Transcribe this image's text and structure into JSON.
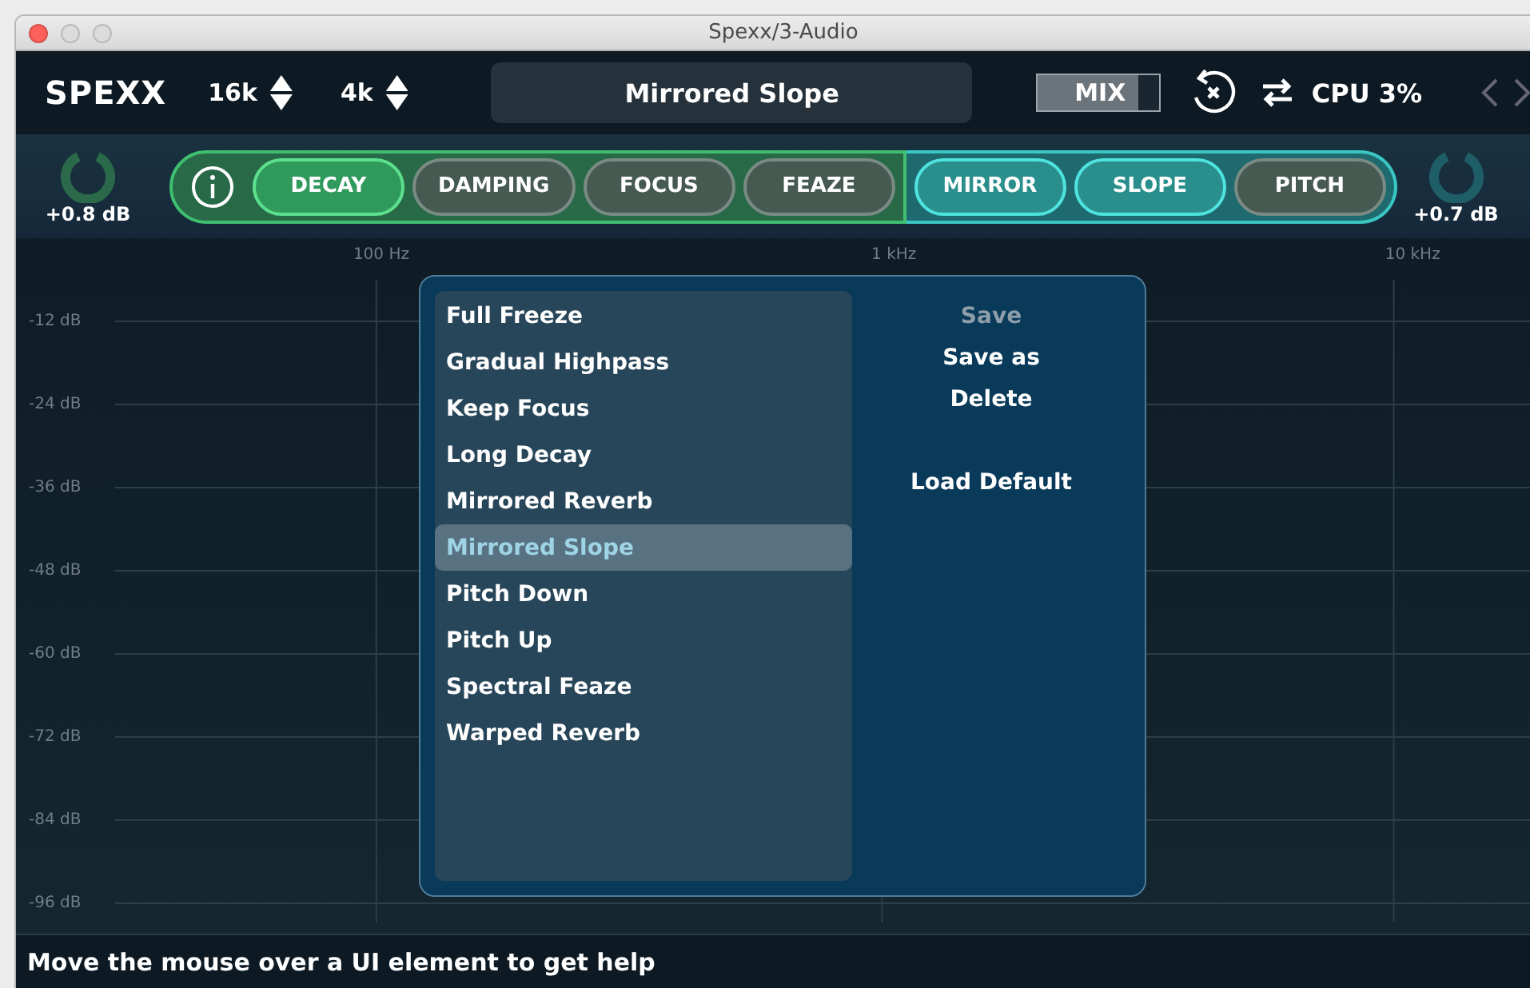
{
  "window": {
    "title": "Spexx/3-Audio"
  },
  "header": {
    "logo": "SPEXX",
    "steppers": [
      {
        "value": "16k"
      },
      {
        "value": "4k"
      }
    ],
    "preset": "Mirrored Slope",
    "mix": {
      "label": "MIX",
      "level": 0.82
    },
    "cpu": "CPU 3%"
  },
  "module_bar": {
    "input_gain": "+0.8 dB",
    "output_gain": "+0.7 dB",
    "groups": [
      {
        "kind": "green",
        "modules": [
          {
            "label": "DECAY",
            "selected": true
          },
          {
            "label": "DAMPING",
            "selected": false
          },
          {
            "label": "FOCUS",
            "selected": false
          },
          {
            "label": "FEAZE",
            "selected": false
          }
        ]
      },
      {
        "kind": "teal",
        "modules": [
          {
            "label": "MIRROR",
            "selected": true
          },
          {
            "label": "SLOPE",
            "selected": true
          },
          {
            "label": "PITCH",
            "selected": false
          }
        ]
      }
    ]
  },
  "spectrum": {
    "freq_labels": [
      "100 Hz",
      "1 kHz",
      "10 kHz"
    ],
    "db_labels": [
      "-12 dB",
      "-24 dB",
      "-36 dB",
      "-48 dB",
      "-60 dB",
      "-72 dB",
      "-84 dB",
      "-96 dB"
    ]
  },
  "preset_menu": {
    "presets": [
      {
        "label": "Full Freeze",
        "selected": false
      },
      {
        "label": "Gradual Highpass",
        "selected": false
      },
      {
        "label": "Keep Focus",
        "selected": false
      },
      {
        "label": "Long Decay",
        "selected": false
      },
      {
        "label": "Mirrored Reverb",
        "selected": false
      },
      {
        "label": "Mirrored Slope",
        "selected": true
      },
      {
        "label": "Pitch Down",
        "selected": false
      },
      {
        "label": "Pitch Up",
        "selected": false
      },
      {
        "label": "Spectral Feaze",
        "selected": false
      },
      {
        "label": "Warped Reverb",
        "selected": false
      }
    ],
    "action_groups": [
      [
        {
          "label": "Save",
          "disabled": true
        },
        {
          "label": "Save as",
          "disabled": false
        },
        {
          "label": "Delete",
          "disabled": false
        }
      ],
      [
        {
          "label": "Load Default",
          "disabled": false
        }
      ]
    ]
  },
  "status_bar": "Move the mouse over a UI element to get help"
}
